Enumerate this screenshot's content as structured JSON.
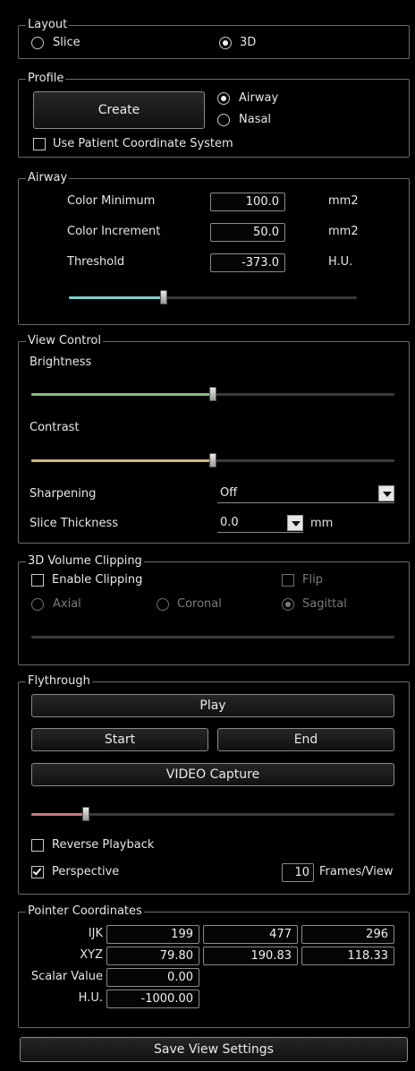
{
  "layout": {
    "title": "Layout",
    "options": [
      "Slice",
      "3D"
    ],
    "selected": "3D"
  },
  "profile": {
    "title": "Profile",
    "create_label": "Create",
    "options": [
      "Airway",
      "Nasal"
    ],
    "selected": "Airway",
    "use_patient_coords_label": "Use Patient Coordinate System",
    "use_patient_coords_checked": false
  },
  "airway": {
    "title": "Airway",
    "rows": [
      {
        "label": "Color Minimum",
        "value": "100.0",
        "unit": "mm2"
      },
      {
        "label": "Color Increment",
        "value": "50.0",
        "unit": "mm2"
      },
      {
        "label": "Threshold",
        "value": "-373.0",
        "unit": "H.U."
      }
    ],
    "threshold_slider_fraction": 0.33,
    "slider_color": "#7ecfcf"
  },
  "view_control": {
    "title": "View Control",
    "brightness_label": "Brightness",
    "brightness_fraction": 0.5,
    "brightness_color": "#7fc07f",
    "contrast_label": "Contrast",
    "contrast_fraction": 0.5,
    "contrast_color": "#cdb77f",
    "sharpening_label": "Sharpening",
    "sharpening_value": "Off",
    "slice_thickness_label": "Slice Thickness",
    "slice_thickness_value": "0.0",
    "slice_thickness_unit": "mm"
  },
  "clipping": {
    "title": "3D Volume Clipping",
    "enable_label": "Enable Clipping",
    "enable_checked": false,
    "flip_label": "Flip",
    "flip_checked": false,
    "options": [
      "Axial",
      "Coronal",
      "Sagittal"
    ],
    "selected": "Sagittal"
  },
  "flythrough": {
    "title": "Flythrough",
    "play_label": "Play",
    "start_label": "Start",
    "end_label": "End",
    "video_label": "VIDEO Capture",
    "position_fraction": 0.15,
    "slider_color": "#c87a7a",
    "reverse_label": "Reverse Playback",
    "reverse_checked": false,
    "perspective_label": "Perspective",
    "perspective_checked": true,
    "frames_value": "10",
    "frames_label": "Frames/View"
  },
  "pointer": {
    "title": "Pointer Coordinates",
    "ijk_label": "IJK",
    "ijk": [
      "199",
      "477",
      "296"
    ],
    "xyz_label": "XYZ",
    "xyz": [
      "79.80",
      "190.83",
      "118.33"
    ],
    "scalar_label": "Scalar Value",
    "scalar": "0.00",
    "hu_label": "H.U.",
    "hu": "-1000.00"
  },
  "save_label": "Save View Settings"
}
